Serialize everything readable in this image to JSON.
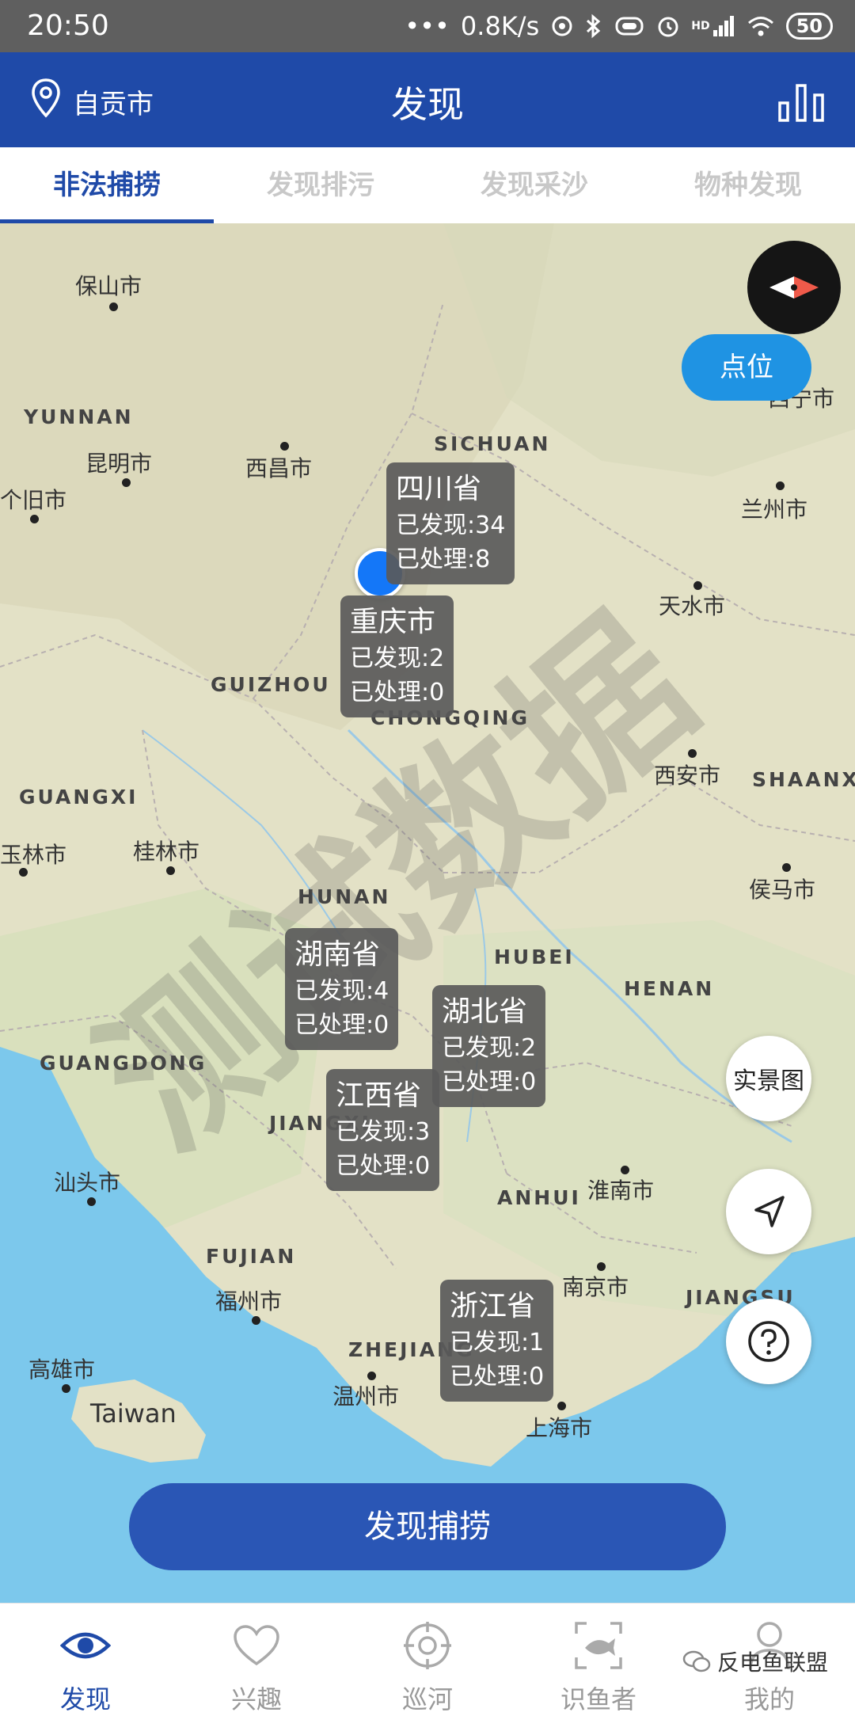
{
  "status_bar": {
    "time": "20:50",
    "network_speed": "0.8K/s",
    "battery": "50",
    "signal_label": "HD"
  },
  "header": {
    "location": "自贡市",
    "title": "发现",
    "icons": {
      "location": "location-pin-icon",
      "stats": "bar-chart-icon"
    }
  },
  "tabs": [
    {
      "label": "非法捕捞",
      "active": true
    },
    {
      "label": "发现排污",
      "active": false
    },
    {
      "label": "发现采沙",
      "active": false
    },
    {
      "label": "物种发现",
      "active": false
    }
  ],
  "map": {
    "watermark": "测试数据",
    "cities": [
      {
        "name": "保山市"
      },
      {
        "name": "昆明市"
      },
      {
        "name": "西昌市"
      },
      {
        "name": "个旧市"
      },
      {
        "name": "西宁市"
      },
      {
        "name": "兰州市"
      },
      {
        "name": "天水市"
      },
      {
        "name": "西安市"
      },
      {
        "name": "玉林市"
      },
      {
        "name": "桂林市"
      },
      {
        "name": "侯马市"
      },
      {
        "name": "汕头市"
      },
      {
        "name": "淮南市"
      },
      {
        "name": "南京市"
      },
      {
        "name": "福州市"
      },
      {
        "name": "高雄市"
      },
      {
        "name": "温州市"
      },
      {
        "name": "上海市"
      }
    ],
    "regions": [
      {
        "name": "YUNNAN"
      },
      {
        "name": "SICHUAN"
      },
      {
        "name": "GUIZHOU"
      },
      {
        "name": "CHONGQING"
      },
      {
        "name": "GUANGXI"
      },
      {
        "name": "SHAANXI"
      },
      {
        "name": "HUNAN"
      },
      {
        "name": "HUBEI"
      },
      {
        "name": "HENAN"
      },
      {
        "name": "GUANGDONG"
      },
      {
        "name": "JIANGXI"
      },
      {
        "name": "ANHUI"
      },
      {
        "name": "JIANGSU"
      },
      {
        "name": "FUJIAN"
      },
      {
        "name": "ZHEJIANG"
      },
      {
        "name": "Taiwan"
      }
    ],
    "bubbles": [
      {
        "name": "四川省",
        "found": "已发现:34",
        "handled": "已处理:8"
      },
      {
        "name": "重庆市",
        "found": "已发现:2",
        "handled": "已处理:0"
      },
      {
        "name": "湖南省",
        "found": "已发现:4",
        "handled": "已处理:0"
      },
      {
        "name": "湖北省",
        "found": "已发现:2",
        "handled": "已处理:0"
      },
      {
        "name": "江西省",
        "found": "已发现:3",
        "handled": "已处理:0"
      },
      {
        "name": "浙江省",
        "found": "已发现:1",
        "handled": "已处理:0"
      }
    ],
    "point_button": "点位",
    "realview_button": "实景图",
    "icons": {
      "compass": "compass-icon",
      "locate": "navigate-arrow-icon",
      "help": "question-icon"
    }
  },
  "action_button": "发现捕捞",
  "bottom_nav": [
    {
      "label": "发现",
      "icon": "eye-icon",
      "active": true
    },
    {
      "label": "兴趣",
      "icon": "heart-icon",
      "active": false
    },
    {
      "label": "巡河",
      "icon": "crosshair-icon",
      "active": false
    },
    {
      "label": "识鱼者",
      "icon": "fish-scan-icon",
      "active": false
    },
    {
      "label": "我的",
      "icon": "user-icon",
      "active": false
    }
  ],
  "overlay_tag": "反电鱼联盟",
  "colors": {
    "primary": "#1f4aa8",
    "sea": "#7cc8ec",
    "land": "#e6e3c9",
    "point_blue": "#1477f8"
  }
}
